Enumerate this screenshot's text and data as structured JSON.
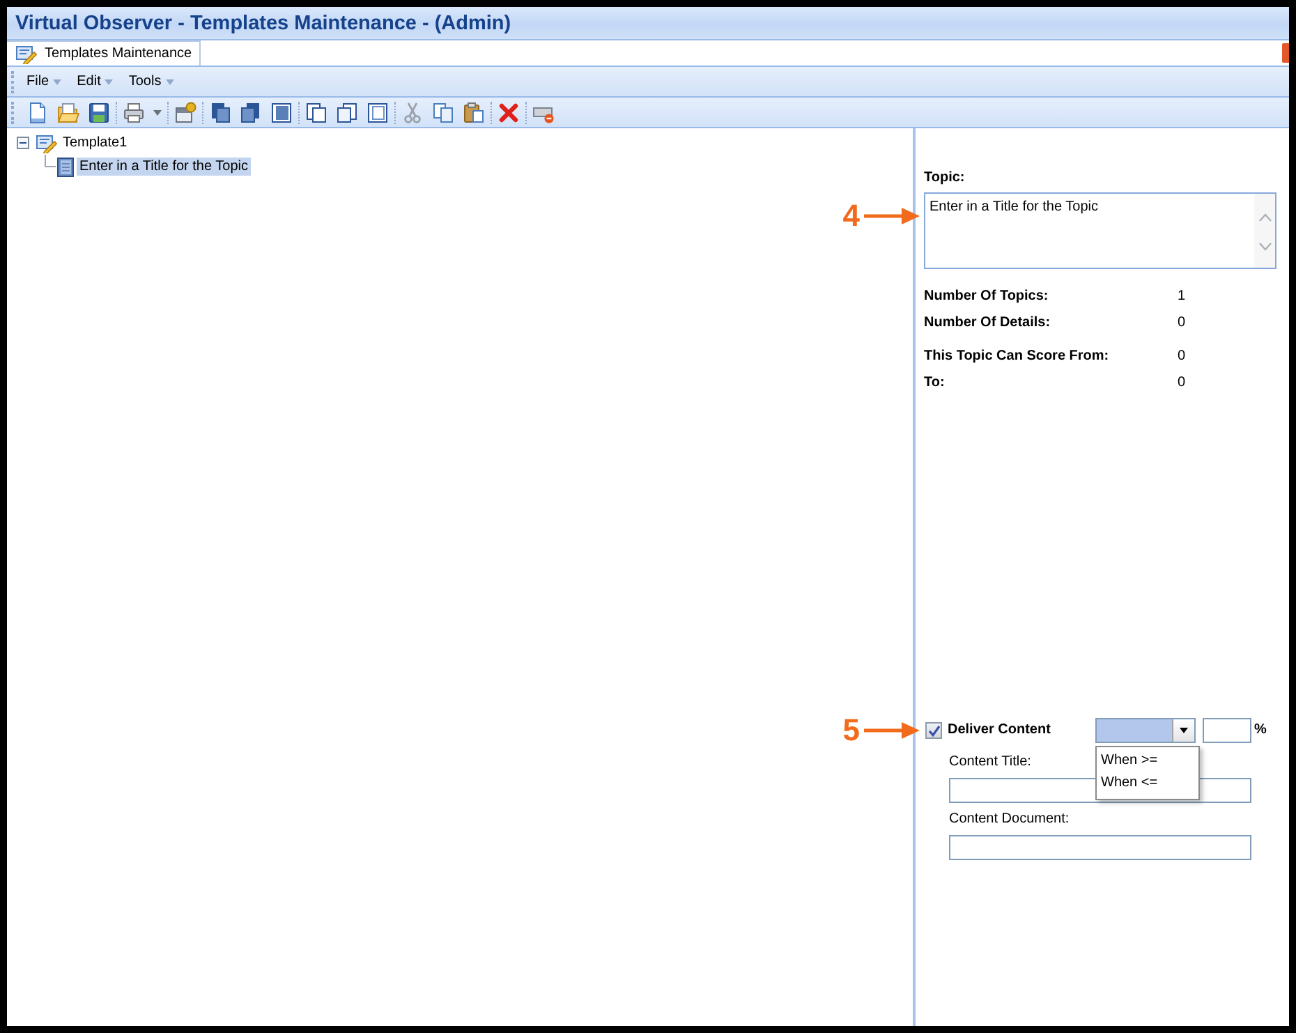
{
  "window": {
    "title": "Virtual Observer - Templates Maintenance - (Admin)"
  },
  "tabs": [
    {
      "label": "Templates Maintenance",
      "selected": true
    }
  ],
  "menu": [
    {
      "label": "File"
    },
    {
      "label": "Edit"
    },
    {
      "label": "Tools"
    }
  ],
  "toolbar": {
    "groups": [
      [
        {
          "kind": "new",
          "disabled": false
        },
        {
          "kind": "open",
          "disabled": false
        },
        {
          "kind": "save",
          "disabled": false
        }
      ],
      [
        {
          "kind": "print",
          "disabled": false
        }
      ],
      [
        {
          "kind": "properties",
          "disabled": false
        }
      ],
      [
        {
          "kind": "stackleft",
          "disabled": false
        },
        {
          "kind": "stackright",
          "disabled": false
        },
        {
          "kind": "stackframe",
          "disabled": false
        }
      ],
      [
        {
          "kind": "pageleft",
          "disabled": false
        },
        {
          "kind": "pageright",
          "disabled": false
        },
        {
          "kind": "pageframe",
          "disabled": false
        }
      ],
      [
        {
          "kind": "cut",
          "disabled": true
        },
        {
          "kind": "copy",
          "disabled": false
        },
        {
          "kind": "paste",
          "disabled": false
        }
      ],
      [
        {
          "kind": "delete",
          "disabled": false
        }
      ],
      [
        {
          "kind": "remove",
          "disabled": false
        }
      ]
    ]
  },
  "tree": [
    {
      "label": "Template1",
      "expanded": true,
      "selected": false,
      "children": [
        {
          "label": "Enter in a Title for the Topic",
          "selected": true
        }
      ]
    }
  ],
  "details": {
    "topic": {
      "label": "Topic:",
      "value": "Enter in a Title for the Topic",
      "callout": "4"
    },
    "stat_groups": [
      [
        {
          "label": "Number Of Topics:",
          "value": "1"
        },
        {
          "label": "Number Of Details:",
          "value": "0"
        }
      ],
      [
        {
          "label": "This Topic Can Score From:",
          "value": "0"
        },
        {
          "label": "To:",
          "value": "0"
        }
      ]
    ],
    "deliver_content": {
      "label": "Deliver Content",
      "checked": true,
      "callout": "5",
      "condition": {
        "expanded": true,
        "options": [
          {
            "label": "When >=",
            "selected": false
          },
          {
            "label": "When <=",
            "selected": false
          }
        ]
      },
      "percent": {
        "unit": "%"
      },
      "fields": [
        {
          "label": "Content Title:"
        },
        {
          "label": "Content Document:"
        }
      ]
    }
  }
}
